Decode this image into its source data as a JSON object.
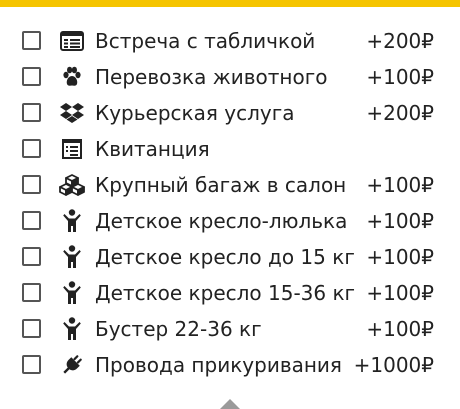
{
  "options": [
    {
      "label": "Встреча с табличкой",
      "price": "+200₽",
      "icon": "id-card-icon"
    },
    {
      "label": "Перевозка животного",
      "price": "+100₽",
      "icon": "paw-icon"
    },
    {
      "label": "Курьерская услуга",
      "price": "+200₽",
      "icon": "dropbox-icon"
    },
    {
      "label": "Квитанция",
      "price": "",
      "icon": "receipt-icon"
    },
    {
      "label": "Крупный багаж в салон",
      "price": "+100₽",
      "icon": "cubes-icon"
    },
    {
      "label": "Детское кресло-люлька",
      "price": "+100₽",
      "icon": "child-icon"
    },
    {
      "label": "Детское кресло до 15 кг",
      "price": "+100₽",
      "icon": "child-icon"
    },
    {
      "label": "Детское кресло 15-36 кг",
      "price": "+100₽",
      "icon": "child-icon"
    },
    {
      "label": "Бустер 22-36 кг",
      "price": "+100₽",
      "icon": "child-icon"
    },
    {
      "label": "Провода прикуривания",
      "price": "+1000₽",
      "icon": "plug-icon"
    }
  ],
  "colors": {
    "accent": "#f5c400",
    "text": "#222222",
    "checkbox_border": "#555555",
    "arrow": "#9a9a9a"
  }
}
